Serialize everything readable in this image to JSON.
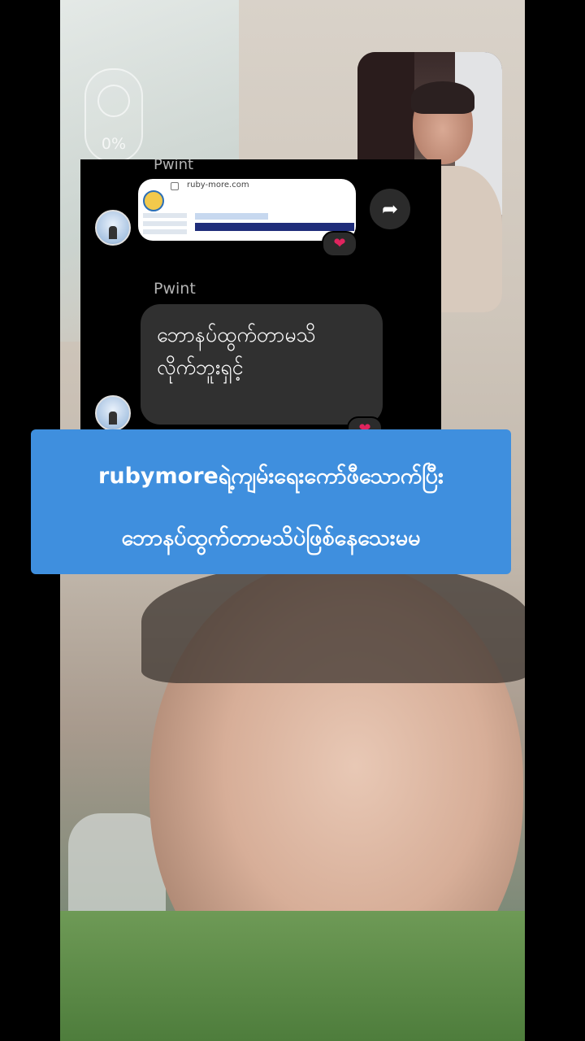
{
  "status": {
    "battery_percent": "0%"
  },
  "chat": {
    "sender_name_1": "Pwint",
    "link_preview": {
      "url": "ruby-more.com"
    },
    "sender_name_2": "Pwint",
    "message_lines": [
      "ဘောနပ်ထွက်တာမသိ",
      "လိုက်ဘူးရှင့်"
    ],
    "reaction": "❤"
  },
  "caption": {
    "lines": [
      "rubymoreရဲ့ကျမ်းရေးကော်ဖီသောက်ပြီး",
      "ဘောနပ်ထွက်တာမသိပဲဖြစ်နေသေးမမ"
    ]
  },
  "icons": {
    "forward": "share-arrow-icon",
    "heart": "heart-icon"
  }
}
